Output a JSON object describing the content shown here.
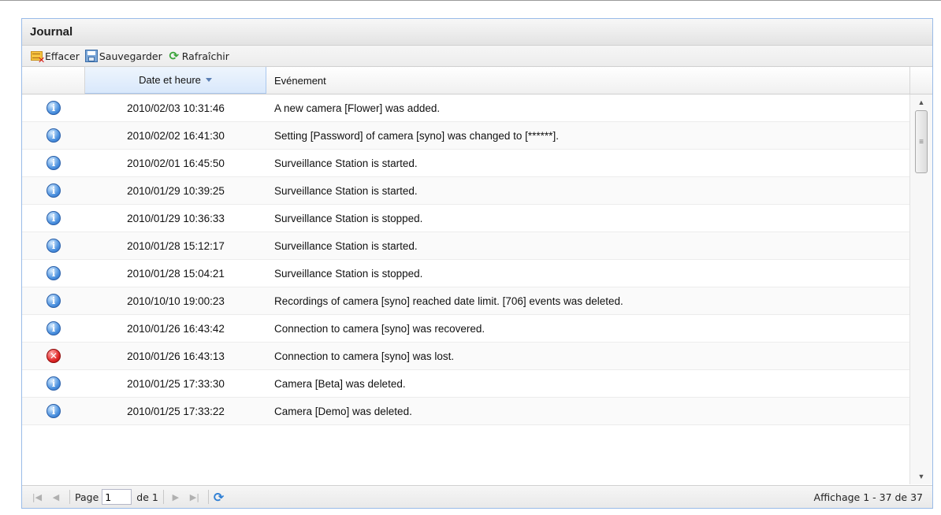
{
  "panel": {
    "title": "Journal"
  },
  "toolbar": {
    "clear_label": "Effacer",
    "save_label": "Sauvegarder",
    "refresh_label": "Rafraîchir"
  },
  "grid": {
    "columns": {
      "date": "Date et heure",
      "event": "Evénement"
    },
    "rows": [
      {
        "level": "info",
        "date": "2010/02/03 10:31:46",
        "event": "A new camera [Flower] was added."
      },
      {
        "level": "info",
        "date": "2010/02/02 16:41:30",
        "event": "Setting [Password] of camera [syno] was changed to [******]."
      },
      {
        "level": "info",
        "date": "2010/02/01 16:45:50",
        "event": "Surveillance Station is started."
      },
      {
        "level": "info",
        "date": "2010/01/29 10:39:25",
        "event": "Surveillance Station is started."
      },
      {
        "level": "info",
        "date": "2010/01/29 10:36:33",
        "event": "Surveillance Station is stopped."
      },
      {
        "level": "info",
        "date": "2010/01/28 15:12:17",
        "event": "Surveillance Station is started."
      },
      {
        "level": "info",
        "date": "2010/01/28 15:04:21",
        "event": "Surveillance Station is stopped."
      },
      {
        "level": "info",
        "date": "2010/10/10 19:00:23",
        "event": "Recordings of camera [syno] reached date limit. [706] events was deleted."
      },
      {
        "level": "info",
        "date": "2010/01/26 16:43:42",
        "event": "Connection to camera [syno] was recovered."
      },
      {
        "level": "error",
        "date": "2010/01/26 16:43:13",
        "event": "Connection to camera [syno] was lost."
      },
      {
        "level": "info",
        "date": "2010/01/25 17:33:30",
        "event": "Camera [Beta] was deleted."
      },
      {
        "level": "info",
        "date": "2010/01/25 17:33:22",
        "event": "Camera [Demo] was deleted."
      }
    ]
  },
  "pager": {
    "page_label": "Page",
    "page_value": "1",
    "of_label": "de 1",
    "display_info": "Affichage 1 - 37 de 37"
  }
}
